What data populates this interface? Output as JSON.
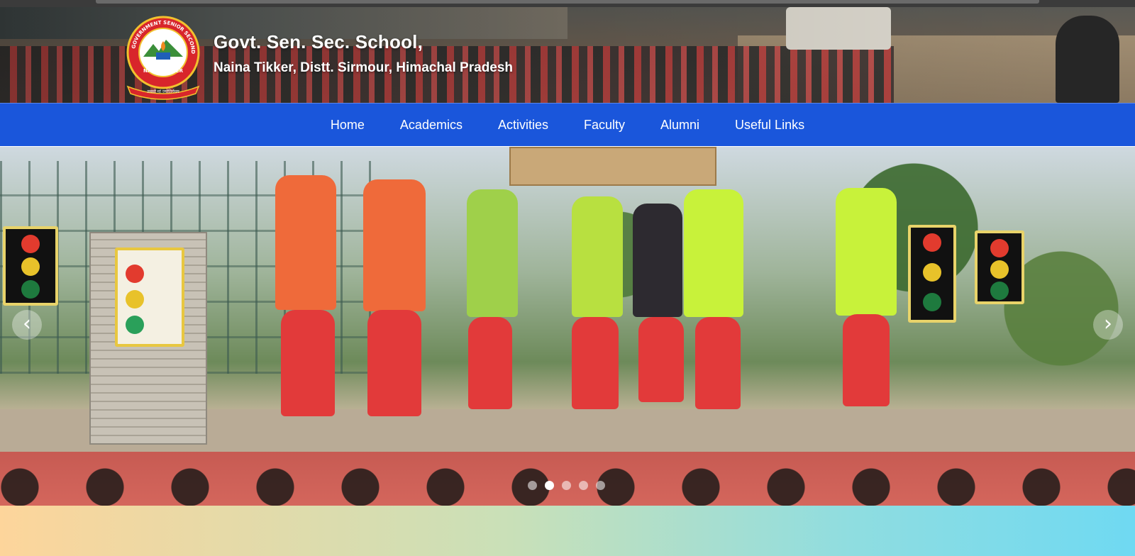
{
  "header": {
    "title": "Govt. Sen. Sec. School,",
    "subtitle": "Naina Tikker, Distt. Sirmour, Himachal Pradesh",
    "logo_ring_text": "GOVERNMENT SENIOR SECONDARY SCHOOL",
    "logo_bottom_text": "NAINA TIKKER",
    "logo_motto": "तमसो मां ज्योतिर्गमय"
  },
  "nav": {
    "items": [
      {
        "label": "Home"
      },
      {
        "label": "Academics"
      },
      {
        "label": "Activities"
      },
      {
        "label": "Faculty"
      },
      {
        "label": "Alumni"
      },
      {
        "label": "Useful Links"
      }
    ]
  },
  "slider": {
    "prev_icon": "chevron-left-icon",
    "next_icon": "chevron-right-icon",
    "prev_glyph": "‹",
    "next_glyph": "›",
    "slide_count": 5,
    "active_index": 1
  },
  "colors": {
    "nav_bg": "#1a56db",
    "band_start": "#fdd59b",
    "band_end": "#6fd9f2"
  }
}
